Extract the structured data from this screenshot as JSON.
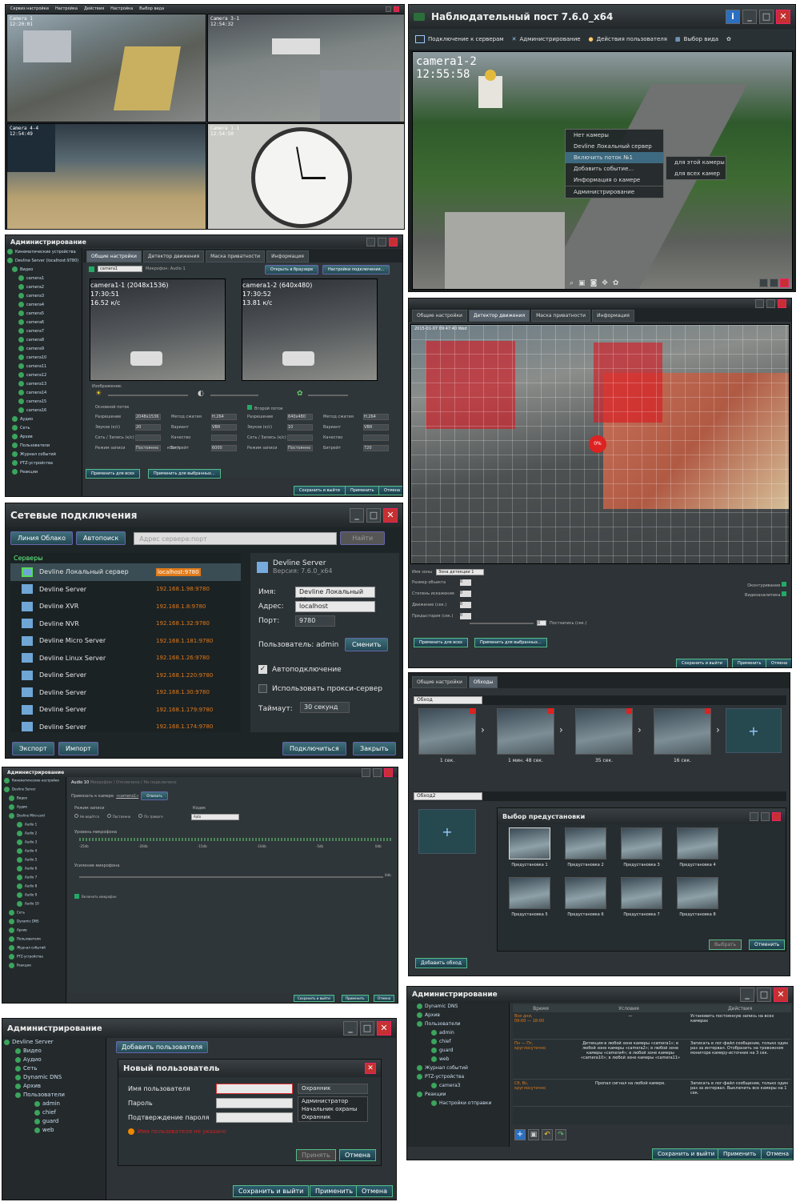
{
  "w1": {
    "tabs": [
      "Сервиз настройки",
      "Настройка",
      "Действия",
      "Настройка",
      "Выбор вида"
    ],
    "cams": [
      {
        "label": "Camera 1\n12:20:01"
      },
      {
        "label": "Camera 3-1\n12:54:32"
      },
      {
        "label": "Camera 4-4\n12:54:49"
      },
      {
        "label": "Camera 1-1\n12:54:50"
      }
    ]
  },
  "w2": {
    "title": "Наблюдательный пост 7.6.0_x64",
    "toolbar": [
      "Подключение к серверам",
      "Администрирование",
      "Действия пользователя",
      "Выбор вида"
    ],
    "osd_name": "camera1-2",
    "osd_time": "12:55:58",
    "menu": [
      "Нет камеры",
      "Devline Локальный сервер",
      "Включить поток №1",
      "Добавить событие...",
      "Информация о камере",
      "Администрирование"
    ],
    "submenu": [
      "для этой камеры",
      "для всех камер"
    ]
  },
  "w3": {
    "title": "Администрирование",
    "tabs": [
      "Общие настройки",
      "Детектор движения",
      "Маска приватности",
      "Информация"
    ],
    "tree": [
      "Кинематические устройства",
      "Devline Server (localhost:9780)",
      "Видео",
      "camera1",
      "camera2",
      "camera3",
      "camera4",
      "camera5",
      "camera6",
      "camera7",
      "camera8",
      "camera9",
      "camera10",
      "camera11",
      "camera12",
      "camera13",
      "camera14",
      "camera15",
      "camera16",
      "Аудио",
      "Сеть",
      "Архив",
      "Пользователи",
      "Журнал событий",
      "PTZ-устройства",
      "Реакции"
    ],
    "cam_field": "camera1",
    "mic_label": "Микрофон: Audio 1",
    "open_btn": "Открыть в браузере",
    "conn_btn": "Настройки подключения...",
    "stream1": {
      "osd": "camera1-1 (2048x1536)",
      "time": "17:30:51",
      "fps": "16.52 к/с"
    },
    "stream2": {
      "osd": "camera1-2 (640x480)",
      "time": "17:30:52",
      "fps": "13.81 к/с"
    },
    "image_lbl": "Изображение:",
    "main_lbl": "Основной поток",
    "second_lbl": "Второй поток",
    "rows": [
      "Разрешение",
      "Звуков (к/с)",
      "Сеть / Запись (к/с)",
      "Режим записи"
    ],
    "rows2": [
      "Метод сжатия",
      "Вариант",
      "Качество",
      "Битрейт"
    ],
    "vals1": [
      "2048x1536",
      "20",
      "",
      "Постоянно"
    ],
    "vals2": [
      "H.264",
      "VBR",
      "",
      "6000"
    ],
    "svals1": [
      "640x480",
      "10",
      "",
      "Постоянно"
    ],
    "svals2": [
      "H.264",
      "VBR",
      "",
      "720"
    ],
    "unit": "кбит/с",
    "apply_all": "Применить для всех",
    "apply_sel": "Применить для выбранных...",
    "save": "Сохранить и выйти",
    "apply": "Применить",
    "cancel": "Отмена"
  },
  "w4": {
    "tabs": [
      "Общие настройки",
      "Детектор движения",
      "Маска приватности",
      "Информация"
    ],
    "osd": "2015-01-07 09:47:40 Wed",
    "zone_lbl": "Имя зоны",
    "zone_val": "Зона детекции 1",
    "params": [
      "Размер объекта",
      "Степень искажения",
      "Движение (сек.)",
      "Предыстория (сек.)"
    ],
    "param_vals": [
      "0",
      "0",
      "0",
      "0"
    ],
    "post_lbl": "Постзапись (сек.)",
    "post_val": "0",
    "chk1": "Оконтуривание",
    "chk2": "Видеоаналитика",
    "apply_all": "Применить для всех",
    "apply_sel": "Применить для выбранных...",
    "save": "Сохранить и выйти",
    "apply": "Применить",
    "cancel": "Отмена",
    "badge": "0%"
  },
  "w5": {
    "title": "Сетевые подключения",
    "btn_cloud": "Линия Облако",
    "btn_auto": "Автопоиск",
    "addr_ph": "Адрес сервера:порт",
    "find": "Найти",
    "servers_hdr": "Серверы",
    "servers": [
      {
        "name": "Devline Локальный сервер",
        "ip": "localhost:9780"
      },
      {
        "name": "Devline Server",
        "ip": "192.168.1.98:9780"
      },
      {
        "name": "Devline XVR",
        "ip": "192.168.1.8:9780"
      },
      {
        "name": "Devline NVR",
        "ip": "192.168.1.32:9780"
      },
      {
        "name": "Devline Micro Server",
        "ip": "192.168.1.181:9780"
      },
      {
        "name": "Devline Linux Server",
        "ip": "192.168.1.26:9780"
      },
      {
        "name": "Devline Server",
        "ip": "192.168.1.220:9780"
      },
      {
        "name": "Devline Server",
        "ip": "192.168.1.30:9780"
      },
      {
        "name": "Devline Server",
        "ip": "192.168.1.179:9780"
      },
      {
        "name": "Devline Server",
        "ip": "192.168.1.174:9780"
      }
    ],
    "detail_name": "Devline Server",
    "detail_ver": "Версия: 7.6.0_x64",
    "name_lbl": "Имя:",
    "name_val": "Devline Локальный се",
    "addr_lbl": "Адрес:",
    "addr_val": "localhost",
    "port_lbl": "Порт:",
    "port_val": "9780",
    "user_lbl": "Пользователь: admin",
    "change": "Сменить",
    "auto": "Автоподключение",
    "proxy": "Использовать прокси-сервер",
    "timeout_lbl": "Таймаут:",
    "timeout_val": "30 секунд",
    "export": "Экспорт",
    "import": "Импорт",
    "connect": "Подключиться",
    "close": "Закрыть"
  },
  "w6": {
    "tabs": [
      "Общие настройки",
      "Обходы"
    ],
    "tour1": "Обход",
    "tour2": "Обход2",
    "steps": [
      "1 сек.",
      "1 мин. 48 сек.",
      "35 сек.",
      "16 сек."
    ],
    "preset_title": "Выбор предустановки",
    "presets": [
      "Предустановка 1",
      "Предустановка 2",
      "Предустановка 3",
      "Предустановка 4",
      "Предустановка 5",
      "Предустановка 6",
      "Предустановка 7",
      "Предустановка 8"
    ],
    "add_tour": "Добавить обход",
    "choose": "Выбрать",
    "cancel": "Отменить"
  },
  "w7": {
    "title": "Администрирование",
    "header": "Audio 10",
    "header_sub": "Микрофон / Отключено / Не подключено",
    "bind_lbl": "Привязать к камере",
    "bind_val": "«camera1»",
    "bind_btn": "Отвязать",
    "rec_lbl": "Режим записи",
    "rec_opts": [
      "Не ведётся",
      "Постоянно",
      "По тревоге"
    ],
    "codec_lbl": "Кодек",
    "codec_val": "Auto",
    "level_lbl": "Уровень микрофона",
    "ticks": [
      "-25db",
      "-20db",
      "-15db",
      "-10db",
      "-5db",
      "0db"
    ],
    "gain_lbl": "Усиление микрофона",
    "gain_val": "0db",
    "enable": "Включить микрофон",
    "tree": [
      "Кинематические настройки",
      "Devline Server",
      "Видео",
      "Аудио",
      "Devline Mini-card",
      "Audio 1",
      "Audio 2",
      "Audio 3",
      "Audio 4",
      "Audio 5",
      "Audio 6",
      "Audio 7",
      "Audio 8",
      "Audio 9",
      "Audio 10",
      "Сеть",
      "Dynamic DNS",
      "Архив",
      "Пользователи",
      "Журнал событий",
      "PTZ-устройства",
      "Реакции"
    ],
    "save": "Сохранить и выйти",
    "apply": "Применить",
    "cancel": "Отмена"
  },
  "w8": {
    "title": "Администрирование",
    "tree": [
      "Devline Server",
      "Видео",
      "Аудио",
      "Сеть",
      "Dynamic DNS",
      "Архив",
      "Пользователи",
      "admin",
      "chief",
      "guard",
      "web"
    ],
    "add_user": "Добавить пользователя",
    "dlg_title": "Новый пользователь",
    "user_lbl": "Имя пользователя",
    "pass_lbl": "Пароль",
    "confirm_lbl": "Подтверждение пароля",
    "role_val": "Охранник",
    "roles": [
      "Администратор",
      "Начальник охраны",
      "Охранник"
    ],
    "err": "Имя пользователя не указано",
    "accept": "Принять",
    "cancel_dlg": "Отмена",
    "save": "Сохранить и выйти",
    "apply": "Применить",
    "cancel": "Отмена"
  },
  "w9": {
    "title": "Администрирование",
    "tree": [
      "Dynamic DNS",
      "Архив",
      "Пользователи",
      "admin",
      "chief",
      "guard",
      "web",
      "Журнал событий",
      "PTZ-устройства",
      "camera3",
      "Реакции",
      "Настройки отправки"
    ],
    "cols": [
      "Время",
      "Условия",
      "Действия"
    ],
    "rules": [
      {
        "time": "Все дни,\n09:00 — 18:00",
        "cond": "—",
        "act": "Установить постоянную запись на всех камерах"
      },
      {
        "time": "Пн — Пт,\nкруглосуточно",
        "cond": "Детекция в любой зоне камеры «camera1»; в любой зоне камеры «camera2»; в любой зоне камеры «camera4»; в любой зоне камеры «camera10»; в любой зоне камеры «camera11»",
        "act": "Записать в лог-файл сообщение, только один раз за интервал. Отобразить на тревожном мониторе камеру-источник на 3 сек."
      },
      {
        "time": "Сб, Вс,\nкруглосуточно",
        "cond": "Пропал сигнал на любой камере.",
        "act": "Записать в лог-файл сообщение, только один раз за интервал. Выключить все камеры на 1 сек."
      }
    ],
    "save": "Сохранить и выйти",
    "apply": "Применить",
    "cancel": "Отмена"
  }
}
